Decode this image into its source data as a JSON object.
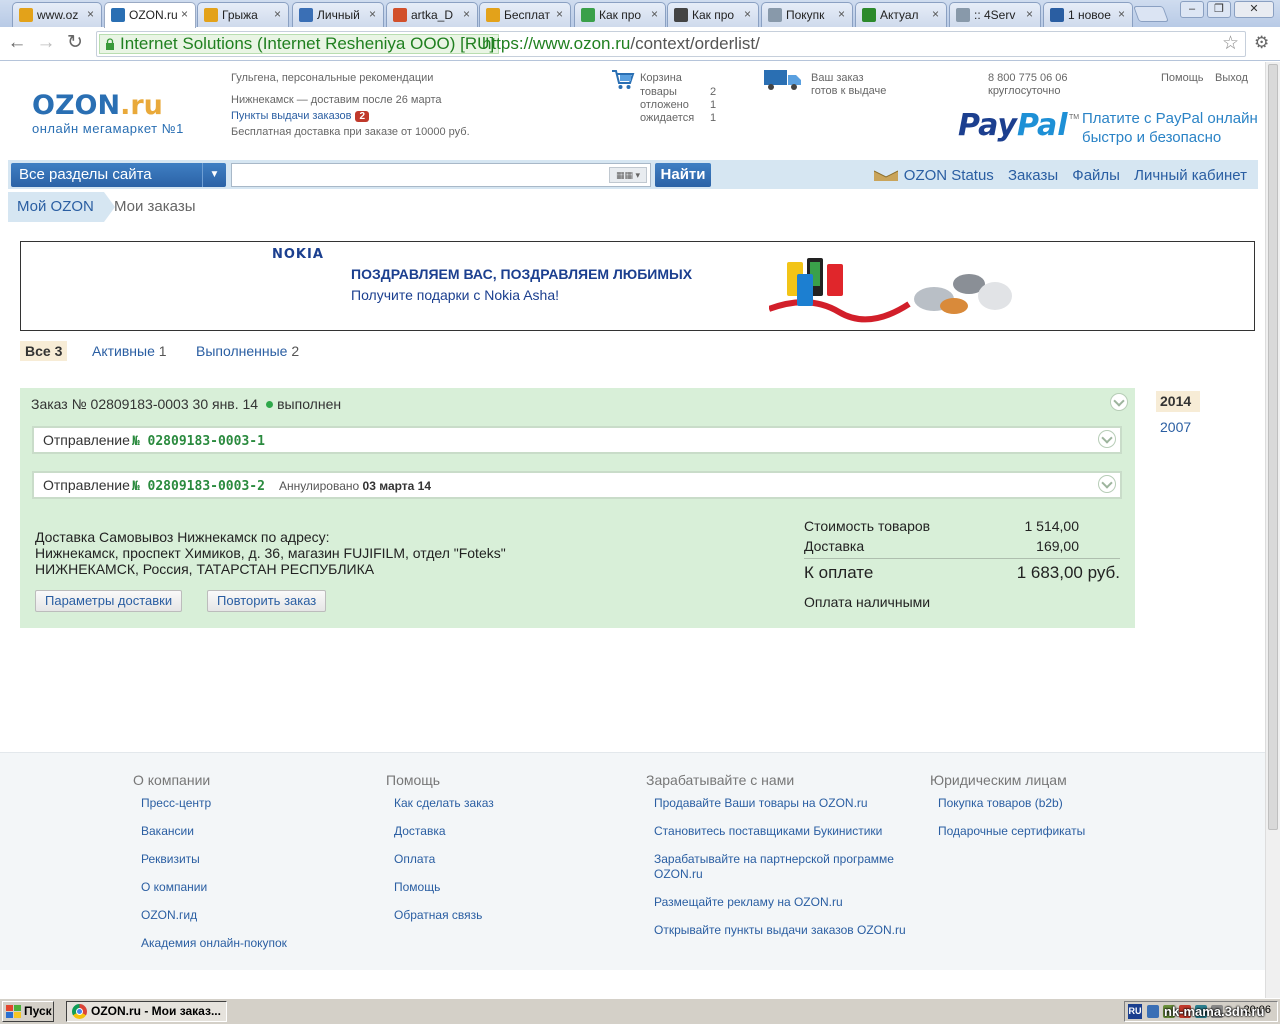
{
  "browser": {
    "tabs": [
      {
        "title": "www.oz",
        "icon": "home-icon",
        "color": "#e3a21a"
      },
      {
        "title": "OZON.ru",
        "icon": "ozon-loading-icon",
        "color": "#2a6fb3",
        "active": true
      },
      {
        "title": "Грыжа",
        "icon": "home-icon",
        "color": "#e3a21a"
      },
      {
        "title": "Личный",
        "icon": "site-icon",
        "color": "#3a6fb5"
      },
      {
        "title": "artka_D",
        "icon": "site-icon",
        "color": "#d2502b"
      },
      {
        "title": "Бесплат",
        "icon": "home-icon",
        "color": "#e3a21a"
      },
      {
        "title": "Как про",
        "icon": "leaf-icon",
        "color": "#3aa04a"
      },
      {
        "title": "Как про",
        "icon": "camera-icon",
        "color": "#444444"
      },
      {
        "title": "Покупк",
        "icon": "page-icon",
        "color": "#8899aa"
      },
      {
        "title": "Актуал",
        "icon": "mail-icon",
        "color": "#2c8a2c"
      },
      {
        "title": ":: 4Serv",
        "icon": "page-icon",
        "color": "#8899aa"
      },
      {
        "title": "1 новое",
        "icon": "counter-icon",
        "color": "#2a5ea2"
      }
    ],
    "ev_name": "Internet Solutions (Internet Resheniya OOO) [RU]",
    "url_host": "https://www.ozon.ru",
    "url_path": "/context/orderlist/"
  },
  "header": {
    "logo": "OZON",
    "logo_dot": ".ru",
    "logo_subtitle": "онлайн мегамаркет №1",
    "greeting": "Гульгена, персональные рекомендации",
    "city": "Нижнекамск",
    "delivery_note": " — доставим после 26 марта",
    "pickup_label": "Пункты выдачи заказов",
    "pickup_count": "2",
    "free_delivery": "Бесплатная доставка при заказе от 10000 руб.",
    "cart": {
      "title": "Корзина",
      "rows": [
        {
          "label": "товары",
          "value": "2"
        },
        {
          "label": "отложено",
          "value": "1"
        },
        {
          "label": "ожидается",
          "value": "1"
        }
      ]
    },
    "order_ready_line1": "Ваш заказ",
    "order_ready_line2": "готов к выдаче",
    "phone": "8 800 775 06 06",
    "phone_hours": "круглосуточно",
    "help": "Помощь",
    "logout": "Выход",
    "paypal_pay": "Pay",
    "paypal_pal": "Pal",
    "paypal_tm": "TM",
    "paypal_line1": "Платите с PayPal онлайн",
    "paypal_line2": "быстро и безопасно"
  },
  "searchbar": {
    "sections": "Все разделы сайта",
    "find": "Найти",
    "status": "OZON Status",
    "orders": "Заказы",
    "files": "Файлы",
    "cabinet": "Личный кабинет"
  },
  "breadcrumb": {
    "root": "Мой OZON",
    "current": "Мои заказы"
  },
  "banner": {
    "brand": "NOKIA",
    "headline": "ПОЗДРАВЛЯЕМ ВАС, ПОЗДРАВЛЯЕМ ЛЮБИМЫХ",
    "subline": "Получите подарки с Nokia Asha!"
  },
  "filters": {
    "all_label": "Все",
    "all_count": "3",
    "active_label": "Активные",
    "active_count": "1",
    "done_label": "Выполненные",
    "done_count": "2"
  },
  "order": {
    "label": "Заказ",
    "number": "№ 02809183-0003",
    "date": "30 янв. 14",
    "status": "выполнен",
    "shipment_label": "Отправление",
    "shipments": [
      {
        "number": "№ 02809183-0003-1",
        "annulled_label": "",
        "annulled_date": ""
      },
      {
        "number": "№ 02809183-0003-2",
        "annulled_label": "Аннулировано",
        "annulled_date": "03 марта 14"
      }
    ],
    "delivery_line1": "Доставка Самовывоз Нижнекамск по адресу:",
    "delivery_line2": "Нижнекамск, проспект Химиков, д. 36, магазин FUJIFILM, отдел \"Foteks\"",
    "delivery_line3": "НИЖНЕКАМСК, Россия, ТАТАРСТАН РЕСПУБЛИКА",
    "btn_params": "Параметры доставки",
    "btn_repeat": "Повторить заказ",
    "goods_label": "Стоимость товаров",
    "goods_value": "1 514,00",
    "delivery_label": "Доставка",
    "delivery_value": "169,00",
    "total_label": "К оплате",
    "total_value": "1 683,00 руб.",
    "payment": "Оплата наличными"
  },
  "years": [
    "2014",
    "2007"
  ],
  "footer": {
    "columns": [
      {
        "title": "О компании",
        "links": [
          "Пресс-центр",
          "Вакансии",
          "Реквизиты",
          "О компании",
          "OZON.гид",
          "Академия онлайн-покупок"
        ]
      },
      {
        "title": "Помощь",
        "links": [
          "Как сделать заказ",
          "Доставка",
          "Оплата",
          "Помощь",
          "Обратная связь"
        ]
      },
      {
        "title": "Зарабатывайте с нами",
        "links": [
          "Продавайте Ваши товары на OZON.ru",
          "Становитесь поставщиками Букинистики",
          "Зарабатывайте на партнерской программе OZON.ru",
          "Размещайте рекламу на OZON.ru",
          "Открывайте пункты выдачи заказов OZON.ru"
        ]
      },
      {
        "title": "Юридическим лицам",
        "links": [
          "Покупка товаров (b2b)",
          "Подарочные сертификаты"
        ]
      }
    ]
  },
  "taskbar": {
    "start": "Пуск",
    "task": "OZON.ru - Мои заказ...",
    "lang": "RU",
    "clock": "20:06"
  },
  "watermark": "nk-mama.3dn.ru"
}
